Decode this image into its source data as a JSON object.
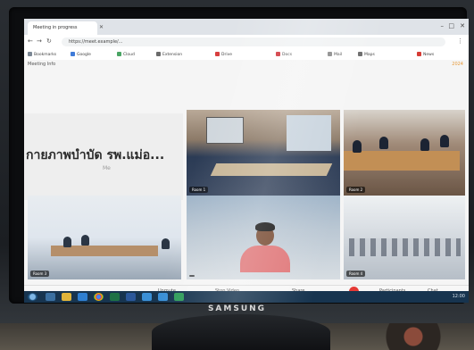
{
  "browser": {
    "tab_title": "Meeting in progress",
    "url": "https://meet.example/...",
    "bookmarks": [
      {
        "label": "Bookmarks",
        "color": "#7b8794"
      },
      {
        "label": "Google",
        "color": "#3f7bd8"
      },
      {
        "label": "Cloud",
        "color": "#4aa564"
      },
      {
        "label": "Extension",
        "color": "#6b6b6b"
      },
      {
        "label": "Drive",
        "color": "#d83f3f"
      },
      {
        "label": "Docs",
        "color": "#d0353c"
      },
      {
        "label": "Mail",
        "color": "#8a8a8a"
      },
      {
        "label": "Maps",
        "color": "#6a6a6a"
      },
      {
        "label": "News",
        "color": "#d63c35"
      }
    ]
  },
  "meeting": {
    "info_label": "Meeting Info",
    "time": "2024",
    "name_tile": {
      "title": "กายภาพบำบัด รพ.แม่อ...",
      "subtitle": "Me"
    },
    "tiles": [
      {
        "label": "Room 1"
      },
      {
        "label": "Room 2"
      },
      {
        "label": "Room 3"
      },
      {
        "label": ""
      },
      {
        "label": "Room 4"
      }
    ]
  },
  "toolbar": {
    "items": [
      "Unmute",
      "Stop Video",
      "Share",
      "Participants",
      "Chat"
    ]
  },
  "taskbar": {
    "tray_text": "12:00"
  },
  "monitor": {
    "brand": "SAMSUNG"
  }
}
